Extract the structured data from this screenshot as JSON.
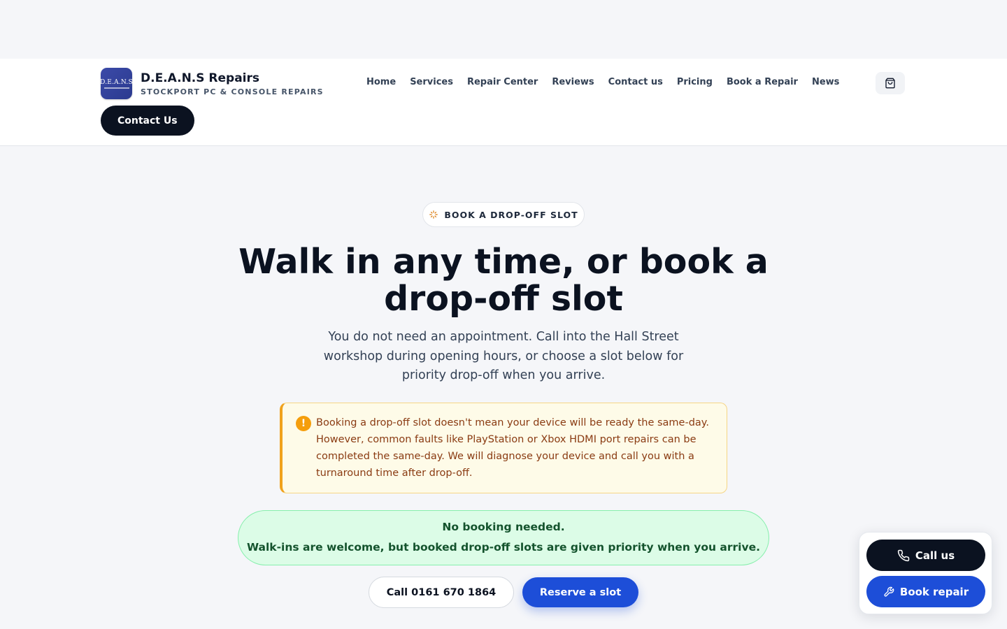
{
  "brand": {
    "logo_text": "D.E.A.N.S",
    "name": "D.E.A.N.S Repairs",
    "tagline": "STOCKPORT PC & CONSOLE REPAIRS"
  },
  "nav": {
    "items": [
      "Home",
      "Services",
      "Repair Center",
      "Reviews",
      "Contact us",
      "Pricing",
      "Book a Repair",
      "News"
    ]
  },
  "header": {
    "cart_icon": "shopping-bag-icon",
    "cta_label": "Contact Us"
  },
  "hero": {
    "badge_icon": "sparkle-icon",
    "badge": "BOOK A DROP-OFF SLOT",
    "title": "Walk in any time, or book a drop-off slot",
    "lead": "You do not need an appointment. Call into the Hall Street workshop during opening hours, or choose a slot below for priority drop-off when you arrive."
  },
  "notice": {
    "icon": "!",
    "text": "Booking a drop-off slot doesn't mean your device will be ready the same-day. However, common faults like PlayStation or Xbox HDMI port repairs can be completed the same-day. We will diagnose your device and call you with a turnaround time after drop-off."
  },
  "info": {
    "title": "No booking needed.",
    "text": "Walk-ins are welcome, but booked drop-off slots are given priority when you arrive."
  },
  "actions": {
    "call_label": "Call 0161 670 1864",
    "reserve_label": "Reserve a slot"
  },
  "floating": {
    "call_label": "Call us",
    "book_label": "Book repair"
  },
  "colors": {
    "primary": "#1d4ed8",
    "dark": "#0b1220",
    "warning": "#f59e0b",
    "success_bg": "#dcfce7"
  }
}
